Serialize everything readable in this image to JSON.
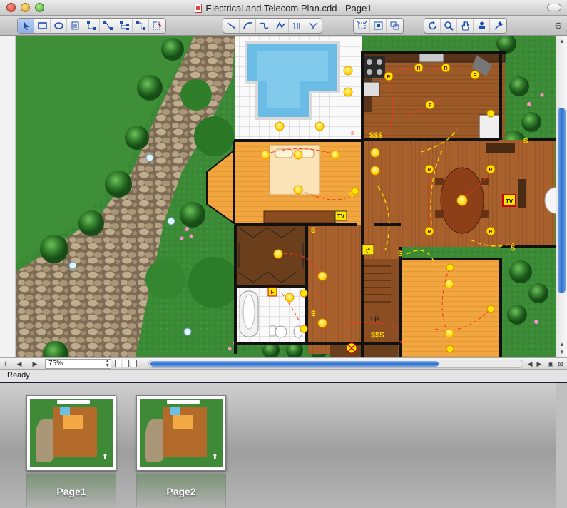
{
  "window": {
    "title": "Electrical and Telecom Plan.cdd - Page1",
    "status": "Ready",
    "zoom": "75%"
  },
  "toolbar": {
    "groups": [
      {
        "name": "selection-tools",
        "items": [
          {
            "name": "pointer-tool",
            "icon": "arrow-pointer-icon"
          },
          {
            "name": "rectangle-tool",
            "icon": "rectangle-icon"
          },
          {
            "name": "ellipse-tool",
            "icon": "ellipse-icon"
          },
          {
            "name": "text-tool",
            "icon": "text-block-icon"
          },
          {
            "name": "connector-tool",
            "icon": "connector-icon"
          },
          {
            "name": "smart-connector-tool",
            "icon": "smart-connector-icon"
          },
          {
            "name": "tree-connector-tool",
            "icon": "tree-connector-icon"
          },
          {
            "name": "chain-tool",
            "icon": "chain-icon"
          },
          {
            "name": "insert-tool",
            "icon": "insert-icon"
          }
        ]
      },
      {
        "name": "drawing-tools",
        "items": [
          {
            "name": "line-tool",
            "icon": "line-icon"
          },
          {
            "name": "arc-tool",
            "icon": "arc-icon"
          },
          {
            "name": "bezier-tool",
            "icon": "bezier-icon"
          },
          {
            "name": "polyline-tool",
            "icon": "polyline-icon"
          },
          {
            "name": "freehand-tool",
            "icon": "freehand-icon"
          },
          {
            "name": "spline-tool",
            "icon": "spline-icon"
          }
        ]
      },
      {
        "name": "crop-tools",
        "items": [
          {
            "name": "crop-tool",
            "icon": "crop-icon"
          },
          {
            "name": "fit-tool",
            "icon": "fit-icon"
          },
          {
            "name": "group-tool",
            "icon": "group-icon"
          }
        ]
      },
      {
        "name": "view-tools",
        "items": [
          {
            "name": "rotate-tool",
            "icon": "rotate-icon"
          },
          {
            "name": "zoom-tool",
            "icon": "magnifier-icon"
          },
          {
            "name": "pan-tool",
            "icon": "hand-icon"
          },
          {
            "name": "stamp-tool",
            "icon": "stamp-icon"
          },
          {
            "name": "eyedropper-tool",
            "icon": "eyedropper-icon"
          }
        ]
      }
    ]
  },
  "plan": {
    "tv_label": "TV",
    "up_label": "up",
    "s_label": "S",
    "thermostat_label": "t°",
    "range_label": "R",
    "fan_label": "F",
    "switch_label": "$",
    "switches_label": "$$$",
    "three_way_label": "3"
  },
  "pages": [
    {
      "label": "Page1"
    },
    {
      "label": "Page2"
    }
  ],
  "colors": {
    "accent": "#2f6fd0",
    "grass": "#3b8a36",
    "wood": "#a8612c",
    "light_wood": "#f2a63f",
    "tile": "#ffffff",
    "pool": "#7cc8ea",
    "wall": "#111111",
    "fixture": "#ffe600",
    "wire": "#ff3020"
  }
}
